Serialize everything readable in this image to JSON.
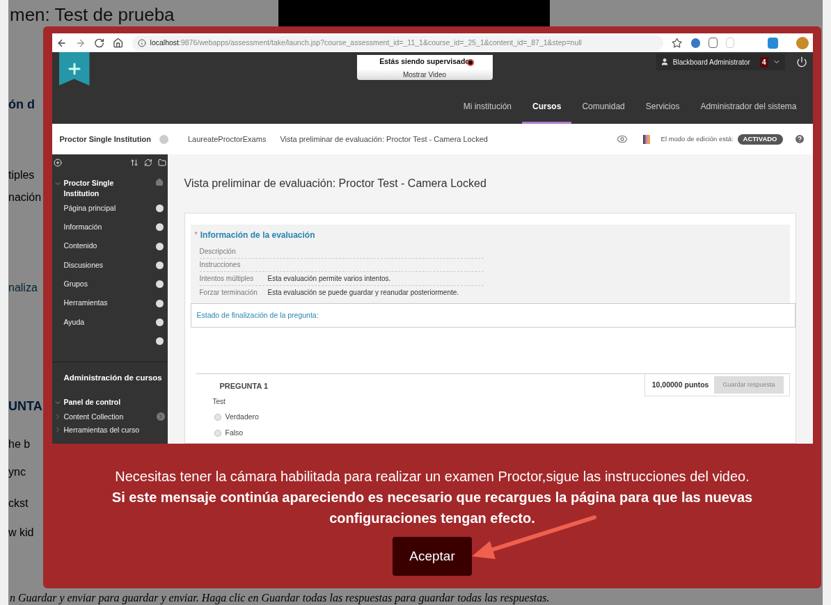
{
  "background": {
    "title": "men: Test de prueba",
    "fragments": [
      {
        "text": "ón d",
        "kind": "heading"
      },
      {
        "text": "tiples",
        "kind": "text"
      },
      {
        "text": "nación",
        "kind": "text"
      },
      {
        "text": "naliza",
        "kind": "link"
      },
      {
        "text": "UNTA",
        "kind": "heading"
      },
      {
        "text": "he b",
        "kind": "text"
      },
      {
        "text": "ync",
        "kind": "text"
      },
      {
        "text": "ckst",
        "kind": "text"
      },
      {
        "text": "w kid",
        "kind": "text"
      }
    ],
    "footer_line": "n Guardar y enviar para guardar y enviar. Haga clic en Guardar todas las respuestas para guardar todas las respuestas."
  },
  "browser": {
    "url_host": "localhost",
    "url_rest": ":9876/webapps/assessment/take/launch.jsp?course_assessment_id=_11_1&course_id=_25_1&content_id=_87_1&step=null"
  },
  "proctor": {
    "status": "Estás siendo supervisado",
    "button": "Mostrar Video"
  },
  "user": {
    "name": "Blackboard Administrator",
    "badge": "4"
  },
  "nav": [
    {
      "label": "Mi institución",
      "selected": false
    },
    {
      "label": "Cursos",
      "selected": true
    },
    {
      "label": "Comunidad",
      "selected": false
    },
    {
      "label": "Servicios",
      "selected": false
    },
    {
      "label": "Administrador del sistema",
      "selected": false
    }
  ],
  "breadcrumbs": [
    "Proctor Single Institution",
    "LaureateProctorExams",
    "Vista preliminar de evaluación: Proctor Test - Camera Locked"
  ],
  "edit_mode": {
    "label": "El modo de edición está:",
    "value": "ACTIVADO",
    "on": true
  },
  "sidebar": {
    "course": "Proctor Single Institution",
    "items": [
      "Página principal",
      "Información",
      "Contenido",
      "Discusiones",
      "Grupos",
      "Herramientas",
      "Ayuda"
    ],
    "admin_title": "Administración de cursos",
    "panel": "Panel de control",
    "panel_items": [
      "Content Collection",
      "Herramientas del curso"
    ]
  },
  "page_title": "Vista preliminar de evaluación: Proctor Test - Camera Locked",
  "info": {
    "required_mark": "*",
    "title": "Información de la evaluación",
    "rows": [
      {
        "label": "Descripción"
      },
      {
        "label": "Instrucciones"
      },
      {
        "label": "Intentos múltiples",
        "value": "Esta evaluación permite varios intentos."
      },
      {
        "label": "Forzar terminación",
        "value": "Esta evaluación se puede guardar y reanudar posteriormente."
      }
    ]
  },
  "status_link": "Estado de finalización de la pregunta:",
  "question": {
    "title": "PREGUNTA 1",
    "points": "10,00000 puntos",
    "save": "Guardar respuesta",
    "text": "Test",
    "options": [
      {
        "label": "Verdadero",
        "selected": false
      },
      {
        "label": "Falso",
        "selected": false
      }
    ]
  },
  "modal": {
    "message": "Necesitas tener la cámara habilitada para realizar un examen Proctor,sigue las instrucciones del video.",
    "bold_message": "Si este mensaje continúa apareciendo es necesario que recargues la página para que las nuevas configuraciones tengan efecto.",
    "button": "Aceptar"
  }
}
